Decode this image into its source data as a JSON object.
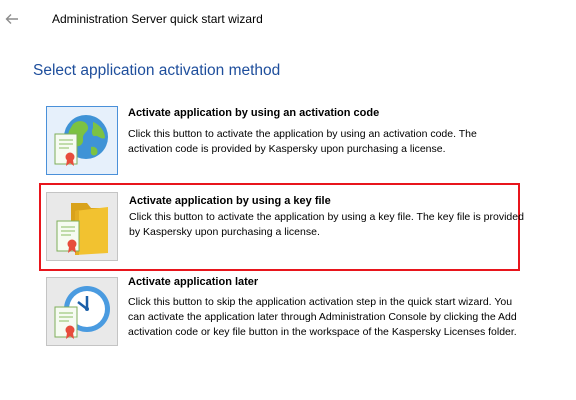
{
  "window": {
    "title": "Administration Server quick start wizard",
    "back_icon": "arrow-left-icon"
  },
  "page": {
    "heading": "Select application activation method"
  },
  "options": [
    {
      "title": "Activate application by using an activation code",
      "description": "Click this button to activate the application by using an activation code. The activation code is provided by Kaspersky upon purchasing a license.",
      "icon": "globe-certificate-icon",
      "selected": false
    },
    {
      "title": "Activate application by using a key file",
      "description": "Click this button to activate the application by using a key file. The key file is provided by Kaspersky upon purchasing a license.",
      "icon": "folder-certificate-icon",
      "selected": true
    },
    {
      "title": "Activate application later",
      "description": "Click this button to skip the application activation step in the quick start wizard. You can activate the application later through Administration Console by clicking the Add activation code or key file button in the workspace of the Kaspersky Licenses folder.",
      "icon": "clock-certificate-icon",
      "selected": false
    }
  ],
  "colors": {
    "heading": "#1e4e9c",
    "selection_border": "#e8151c",
    "tile_selected_border": "#4a90d9"
  }
}
